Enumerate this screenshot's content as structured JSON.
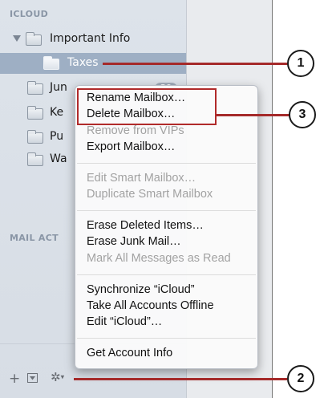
{
  "sidebar": {
    "icloud_header": "ICLOUD",
    "mail_activity_header": "MAIL ACT",
    "mailboxes": [
      {
        "label": "Important Info",
        "selected": false,
        "expanded": true
      },
      {
        "label": "Taxes",
        "selected": true
      },
      {
        "label": "Jun",
        "badge": "20"
      },
      {
        "label": "Ke"
      },
      {
        "label": "Pu"
      },
      {
        "label": "Wa"
      }
    ]
  },
  "context_menu": {
    "items": [
      {
        "label": "Rename Mailbox…",
        "enabled": true
      },
      {
        "label": "Delete Mailbox…",
        "enabled": true
      },
      {
        "label": "Remove from VIPs",
        "enabled": false
      },
      {
        "label": "Export Mailbox…",
        "enabled": true
      },
      {
        "label": "Edit Smart Mailbox…",
        "enabled": false
      },
      {
        "label": "Duplicate Smart Mailbox",
        "enabled": false
      },
      {
        "label": "Erase Deleted Items…",
        "enabled": true
      },
      {
        "label": "Erase Junk Mail…",
        "enabled": true
      },
      {
        "label": "Mark All Messages as Read",
        "enabled": false
      },
      {
        "label": "Synchronize “iCloud”",
        "enabled": true
      },
      {
        "label": "Take All Accounts Offline",
        "enabled": true
      },
      {
        "label": "Edit “iCloud”…",
        "enabled": true
      },
      {
        "label": "Get Account Info",
        "enabled": true
      }
    ]
  },
  "toolbar": {
    "add_label": "+",
    "action_label": "✲"
  },
  "callouts": [
    "1",
    "2",
    "3"
  ],
  "colors": {
    "selection": "#9eafc4",
    "callout_line": "#a52a2a",
    "sidebar_bg": "#dde3ea"
  }
}
